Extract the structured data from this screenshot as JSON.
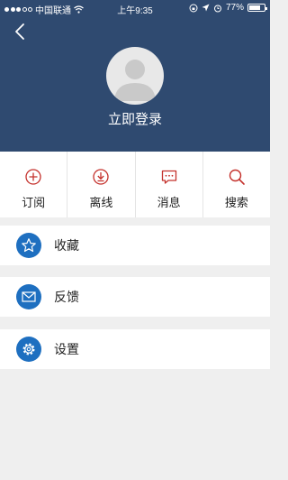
{
  "status_bar": {
    "carrier": "中国联通",
    "time": "上午9:35",
    "battery_percent": "77%",
    "battery_level": 0.77
  },
  "header": {
    "back_icon": "chevron-left-icon",
    "login_text": "立即登录"
  },
  "quick_actions": [
    {
      "label": "订阅",
      "icon": "plus-circle-icon"
    },
    {
      "label": "离线",
      "icon": "download-icon"
    },
    {
      "label": "消息",
      "icon": "message-icon"
    },
    {
      "label": "搜索",
      "icon": "search-icon"
    }
  ],
  "menu": [
    {
      "label": "收藏",
      "icon": "star-icon"
    },
    {
      "label": "反馈",
      "icon": "mail-icon"
    },
    {
      "label": "设置",
      "icon": "gear-icon"
    }
  ],
  "colors": {
    "header_bg": "#2f4a70",
    "accent_red": "#c4302b",
    "menu_icon_bg": "#1e6fc0",
    "page_bg": "#efefef"
  }
}
